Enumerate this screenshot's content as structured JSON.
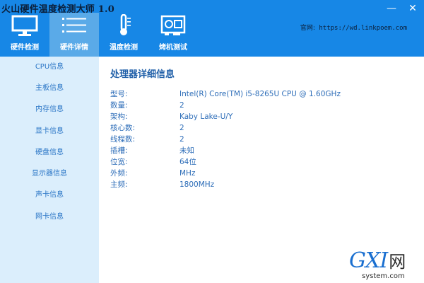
{
  "app": {
    "title": "火山硬件温度检测大师 1.0"
  },
  "window_controls": {
    "minimize": "—",
    "close": "✕"
  },
  "nav": [
    {
      "label": "硬件检测",
      "icon": "monitor-icon",
      "active": false
    },
    {
      "label": "硬件详情",
      "icon": "list-icon",
      "active": true
    },
    {
      "label": "温度检测",
      "icon": "thermometer-icon",
      "active": false
    },
    {
      "label": "烤机测试",
      "icon": "gpu-card-icon",
      "active": false
    }
  ],
  "website": {
    "label": "官网:",
    "url": "https://wd.linkpoem.com"
  },
  "sidebar": {
    "items": [
      {
        "label": "CPU信息"
      },
      {
        "label": "主板信息"
      },
      {
        "label": "内存信息"
      },
      {
        "label": "显卡信息"
      },
      {
        "label": "硬盘信息"
      },
      {
        "label": "显示器信息"
      },
      {
        "label": "声卡信息"
      },
      {
        "label": "网卡信息"
      }
    ]
  },
  "detail": {
    "title": "处理器详细信息",
    "rows": [
      {
        "key": "型号:",
        "value": "Intel(R) Core(TM) i5-8265U CPU @ 1.60GHz"
      },
      {
        "key": "数量:",
        "value": "2"
      },
      {
        "key": "架构:",
        "value": "Kaby Lake-U/Y"
      },
      {
        "key": "核心数:",
        "value": "2"
      },
      {
        "key": "线程数:",
        "value": "2"
      },
      {
        "key": "插槽:",
        "value": "未知"
      },
      {
        "key": "位宽:",
        "value": "64位"
      },
      {
        "key": "外频:",
        "value": "MHz"
      },
      {
        "key": "主频:",
        "value": "1800MHz"
      }
    ]
  },
  "watermark": {
    "brand": "GXI",
    "brand_cn": "网",
    "domain": "system.com"
  },
  "colors": {
    "topbar": "#1787e6",
    "sidebar": "#dbeefc",
    "active_tab": "#5aaae8",
    "text": "#2d6db8"
  }
}
